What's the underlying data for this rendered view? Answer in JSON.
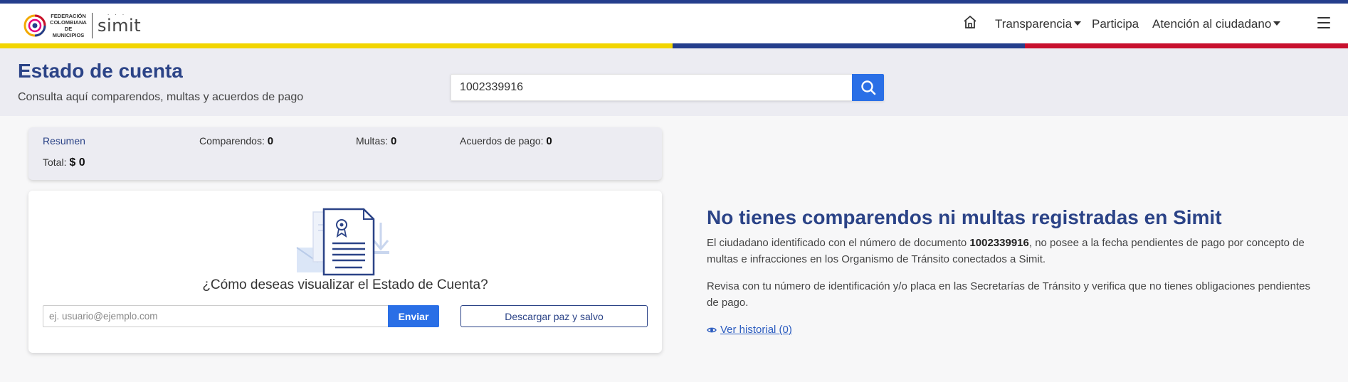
{
  "header": {
    "logo_text": [
      "FEDERACIÓN",
      "COLOMBIANA",
      "DE MUNICIPIOS"
    ],
    "brand": "simit",
    "nav": [
      {
        "label": "Transparencia",
        "dropdown": true
      },
      {
        "label": "Participa",
        "dropdown": false
      },
      {
        "label": "Atención al ciudadano",
        "dropdown": true
      }
    ],
    "icons": {
      "home": "home-icon",
      "menu": "hamburger-menu-icon"
    }
  },
  "title_band": {
    "title": "Estado de cuenta",
    "subtitle": "Consulta aquí comparendos, multas y acuerdos de pago",
    "search_value": "1002339916",
    "search_icon": "search-icon"
  },
  "resumen": {
    "heading": "Resumen",
    "comparendos_label": "Comparendos:",
    "comparendos_value": "0",
    "multas_label": "Multas:",
    "multas_value": "0",
    "acuerdos_label": "Acuerdos de pago:",
    "acuerdos_value": "0",
    "total_label": "Total:",
    "total_value": "$ 0"
  },
  "visualize": {
    "question": "¿Cómo deseas visualizar el Estado de Cuenta?",
    "email_placeholder": "ej. usuario@ejemplo.com",
    "email_value": "",
    "send_label": "Enviar",
    "download_label": "Descargar paz y salvo"
  },
  "message": {
    "title": "No tienes comparendos ni multas registradas en Simit",
    "p1_before": "El ciudadano identificado con el número de documento ",
    "p1_doc": "1002339916",
    "p1_after": ", no posee a la fecha pendientes de pago por concepto de multas e infracciones en los Organismo de Tránsito conectados a Simit.",
    "p2": "Revisa con tu número de identificación y/o placa en las Secretarías de Tránsito y verifica que no tienes obligaciones pendientes de pago.",
    "history_label": "Ver historial (0)",
    "history_icon": "eye-icon"
  },
  "colors": {
    "brand_blue": "#2b4387",
    "action_blue": "#2a6fe6",
    "flag_yellow": "#f2d500",
    "flag_blue": "#243e8c",
    "flag_red": "#c8102e"
  }
}
